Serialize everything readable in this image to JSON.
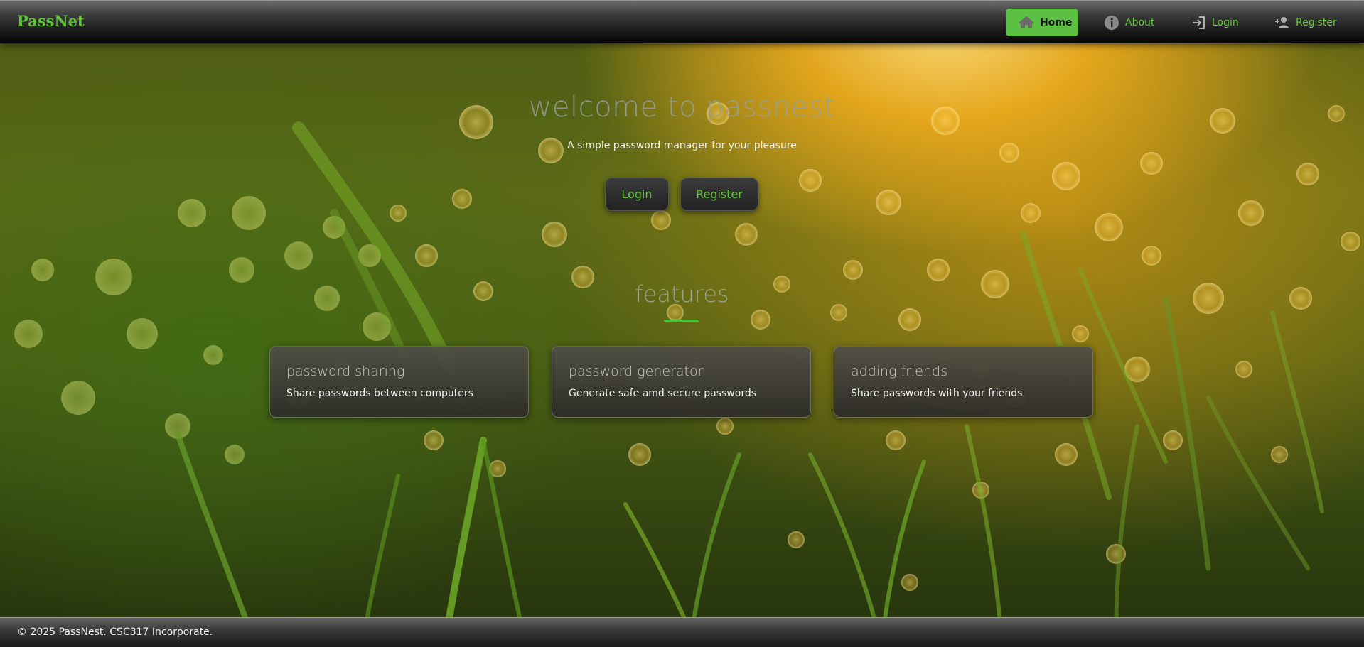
{
  "brand": "PassNet",
  "nav": {
    "home": "Home",
    "about": "About",
    "login": "Login",
    "register": "Register"
  },
  "hero": {
    "title": "welcome to passnest",
    "subtitle": "A simple password manager for your pleasure",
    "login_label": "Login",
    "register_label": "Register"
  },
  "features": {
    "heading": "features",
    "cards": [
      {
        "title": "password sharing",
        "description": "Share passwords between computers"
      },
      {
        "title": "password generator",
        "description": "Generate safe amd secure passwords"
      },
      {
        "title": "adding friends",
        "description": "Share passwords with your friends"
      }
    ]
  },
  "footer": {
    "text": "© 2025 PassNest. CSC317 Incorporate."
  },
  "colors": {
    "accent_green": "#5cc043",
    "nav_text_green": "#68c93a",
    "card_bg": "#3c3b36",
    "footer_bg": "#2a2a2a"
  },
  "icons": {
    "home": "home-icon",
    "about": "info-icon",
    "login": "login-icon",
    "register": "add-user-icon"
  }
}
